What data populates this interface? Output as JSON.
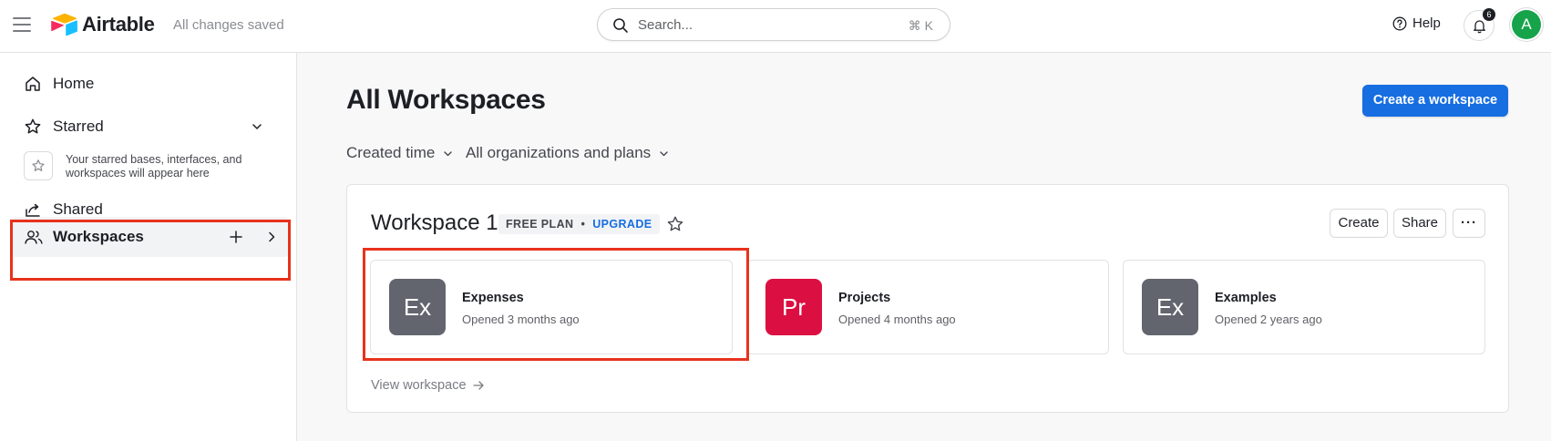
{
  "topbar": {
    "app_name": "Airtable",
    "save_status": "All changes saved",
    "search_placeholder": "Search...",
    "search_shortcut": "⌘ K",
    "help_label": "Help",
    "notification_count": "6",
    "avatar_initial": "A",
    "avatar_color": "#16a34a"
  },
  "sidebar": {
    "home": "Home",
    "starred": "Starred",
    "starred_empty": "Your starred bases, interfaces, and workspaces will appear here",
    "shared": "Shared",
    "workspaces": "Workspaces"
  },
  "main": {
    "title": "All Workspaces",
    "create_workspace": "Create a workspace",
    "filters": {
      "sort": "Created time",
      "orgs": "All organizations and plans"
    },
    "workspace": {
      "name": "Workspace 1",
      "plan": "FREE PLAN",
      "plan_sep": "•",
      "upgrade": "UPGRADE",
      "create_btn": "Create",
      "share_btn": "Share",
      "more_btn": "···",
      "view_link": "View workspace",
      "bases": [
        {
          "abbr": "Ex",
          "name": "Expenses",
          "opened": "Opened 3 months ago",
          "color": "#62656e"
        },
        {
          "abbr": "Pr",
          "name": "Projects",
          "opened": "Opened 4 months ago",
          "color": "#dc0f42"
        },
        {
          "abbr": "Ex",
          "name": "Examples",
          "opened": "Opened 2 years ago",
          "color": "#62656e"
        }
      ]
    }
  },
  "colors": {
    "accent": "#166ee1",
    "highlight": "#e8321d"
  }
}
